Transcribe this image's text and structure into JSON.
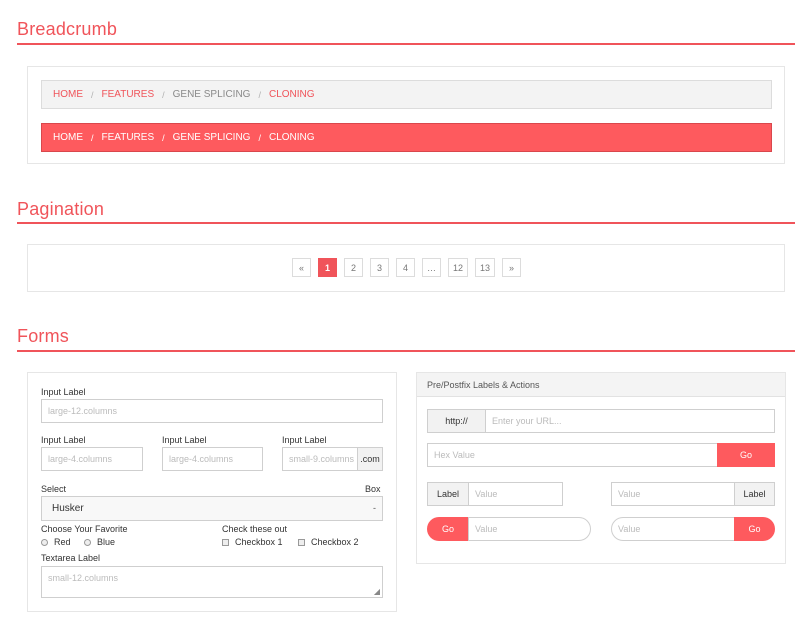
{
  "breadcrumb": {
    "title": "Breadcrumb",
    "items": [
      {
        "label": "Home",
        "link": true
      },
      {
        "label": "Features",
        "link": true
      },
      {
        "label": "Gene Splicing",
        "link": false
      },
      {
        "label": "Cloning",
        "link": true
      }
    ],
    "separator": "/"
  },
  "pagination": {
    "title": "Pagination",
    "items": [
      "«",
      "1",
      "2",
      "3",
      "4",
      "…",
      "12",
      "13",
      "»"
    ],
    "current": "1"
  },
  "forms": {
    "title": "Forms",
    "input_label": "Input Label",
    "large12_placeholder": "large-12.columns",
    "large4_placeholder": "large-4.columns",
    "small9_placeholder": "small-9.columns",
    "postfix_com": ".com",
    "select_label": "Select",
    "select_right_label": "Box",
    "select_value": "Husker",
    "select_caret": "-",
    "radio_title": "Choose Your Favorite",
    "radio_red": "Red",
    "radio_blue": "Blue",
    "check_title": "Check these out",
    "check_1": "Checkbox 1",
    "check_2": "Checkbox 2",
    "textarea_label": "Textarea Label",
    "textarea_placeholder": "small-12.columns"
  },
  "prepost": {
    "header": "Pre/Postfix Labels & Actions",
    "http_prefix": "http://",
    "url_placeholder": "Enter your URL...",
    "hex_placeholder": "Hex Value",
    "go": "Go",
    "label": "Label",
    "value_placeholder": "Value"
  },
  "colors": {
    "accent": "#f0545a",
    "button": "#fe5a5e"
  }
}
